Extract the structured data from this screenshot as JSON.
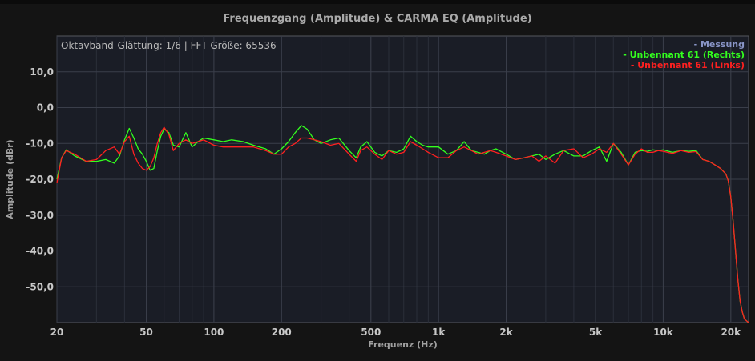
{
  "chart_data": {
    "type": "line",
    "title": "Frequenzgang (Amplitude) & CARMA EQ (Amplitude)",
    "info": "Oktavband-Glättung: 1/6 | FFT Größe: 65536",
    "xlabel": "Frequenz (Hz)",
    "ylabel": "Amplitude (dBr)",
    "xscale": "log",
    "xlim": [
      20,
      24000
    ],
    "ylim": [
      -60,
      20
    ],
    "grid": true,
    "legend_position": "top-right",
    "x_ticks": [
      {
        "value": 20,
        "label": "20"
      },
      {
        "value": 50,
        "label": "50"
      },
      {
        "value": 100,
        "label": "100"
      },
      {
        "value": 200,
        "label": "200"
      },
      {
        "value": 500,
        "label": "500"
      },
      {
        "value": 1000,
        "label": "1k"
      },
      {
        "value": 2000,
        "label": "2k"
      },
      {
        "value": 5000,
        "label": "5k"
      },
      {
        "value": 10000,
        "label": "10k"
      },
      {
        "value": 20000,
        "label": "20k"
      }
    ],
    "y_ticks": [
      {
        "value": 10,
        "label": "10,0"
      },
      {
        "value": 0,
        "label": "0,0"
      },
      {
        "value": -10,
        "label": "-10,0"
      },
      {
        "value": -20,
        "label": "-20,0"
      },
      {
        "value": -30,
        "label": "-30,0"
      },
      {
        "value": -40,
        "label": "-40,0"
      },
      {
        "value": -50,
        "label": "-50,0"
      }
    ],
    "legend": [
      {
        "label": "- Messung",
        "color": "#8a96c8"
      },
      {
        "label": "- Unbennant 61 (Rechts)",
        "color": "#33ff1e"
      },
      {
        "label": "- Unbennant 61 (Links)",
        "color": "#ff2020"
      }
    ],
    "series": [
      {
        "name": "Unbennant 61 (Rechts)",
        "color": "#33ff1e",
        "x": [
          20,
          21,
          22,
          24,
          27,
          30,
          33,
          36,
          38,
          40,
          42,
          44,
          46,
          48,
          50,
          52,
          54,
          56,
          58,
          60,
          63,
          66,
          70,
          75,
          80,
          85,
          90,
          100,
          110,
          120,
          135,
          150,
          170,
          185,
          200,
          215,
          230,
          245,
          260,
          280,
          300,
          330,
          360,
          400,
          430,
          450,
          480,
          520,
          560,
          600,
          650,
          700,
          750,
          800,
          850,
          900,
          1000,
          1100,
          1200,
          1300,
          1400,
          1500,
          1600,
          1700,
          1800,
          2000,
          2200,
          2400,
          2600,
          2800,
          3000,
          3300,
          3600,
          4000,
          4400,
          4800,
          5200,
          5600,
          6000,
          6500,
          7000,
          7500,
          8000,
          8500,
          9000,
          9500,
          10000,
          11000,
          12000,
          13000,
          14000,
          15000,
          16000,
          17000,
          18000,
          19000,
          19500,
          20000,
          20500,
          21000,
          21500,
          22000,
          22500,
          23000,
          23500,
          24000
        ],
        "y": [
          -20,
          -14,
          -11.8,
          -13.5,
          -15,
          -15,
          -14.5,
          -15.5,
          -13.5,
          -9,
          -5.8,
          -8.5,
          -11.5,
          -13,
          -15,
          -17.5,
          -17,
          -12,
          -8,
          -6,
          -7,
          -10.5,
          -11,
          -7,
          -11,
          -9.5,
          -8.5,
          -9,
          -9.5,
          -9,
          -9.5,
          -10.5,
          -11.5,
          -13,
          -11.5,
          -9.5,
          -7,
          -5,
          -6,
          -9,
          -10,
          -9,
          -8.5,
          -12,
          -14,
          -11,
          -9.5,
          -12.5,
          -13.5,
          -12,
          -12.5,
          -11.5,
          -8,
          -9.5,
          -10.5,
          -11,
          -11,
          -13,
          -12,
          -9.5,
          -12,
          -12.5,
          -13,
          -12,
          -11.5,
          -13,
          -14.5,
          -14,
          -13.5,
          -13,
          -14.5,
          -13,
          -12,
          -13.5,
          -13.5,
          -12,
          -11,
          -15,
          -10,
          -12.5,
          -16,
          -12.5,
          -12,
          -12.2,
          -11.8,
          -12,
          -11.8,
          -12.5,
          -12,
          -12.2,
          -12,
          -14.5,
          -15,
          -16,
          -17,
          -18.5,
          -20.5,
          -25,
          -32,
          -40,
          -48,
          -54,
          -57,
          -59,
          -59.5,
          -60
        ]
      },
      {
        "name": "Unbennant 61 (Links)",
        "color": "#ff2020",
        "x": [
          20,
          21,
          22,
          24,
          27,
          30,
          33,
          36,
          38,
          40,
          42,
          44,
          46,
          48,
          50,
          52,
          54,
          56,
          58,
          60,
          63,
          66,
          70,
          75,
          80,
          85,
          90,
          100,
          110,
          120,
          135,
          150,
          170,
          185,
          200,
          215,
          230,
          245,
          260,
          280,
          300,
          330,
          360,
          400,
          430,
          450,
          480,
          520,
          560,
          600,
          650,
          700,
          750,
          800,
          850,
          900,
          1000,
          1100,
          1200,
          1300,
          1400,
          1500,
          1600,
          1700,
          1800,
          2000,
          2200,
          2400,
          2600,
          2800,
          3000,
          3300,
          3600,
          4000,
          4400,
          4800,
          5200,
          5600,
          6000,
          6500,
          7000,
          7500,
          8000,
          8500,
          9000,
          9500,
          10000,
          11000,
          12000,
          13000,
          14000,
          15000,
          16000,
          17000,
          18000,
          19000,
          19500,
          20000,
          20500,
          21000,
          21500,
          22000,
          22500,
          23000,
          23500,
          24000
        ],
        "y": [
          -21,
          -14,
          -12,
          -13,
          -15,
          -14.5,
          -12,
          -11,
          -13,
          -9.5,
          -8,
          -13,
          -15.5,
          -17,
          -17.5,
          -16.5,
          -14,
          -10,
          -7,
          -5.5,
          -7.5,
          -12,
          -10,
          -9,
          -10,
          -9.5,
          -9,
          -10.5,
          -11,
          -11,
          -11,
          -11,
          -12,
          -13,
          -13,
          -11,
          -10,
          -8.5,
          -8.5,
          -9,
          -9.5,
          -10.5,
          -10,
          -13,
          -15,
          -12,
          -11,
          -13,
          -14.5,
          -12,
          -13,
          -12.5,
          -9.5,
          -10.5,
          -11.5,
          -12.5,
          -14,
          -14,
          -12,
          -11,
          -12,
          -13,
          -12.5,
          -12,
          -12.5,
          -13.5,
          -14.5,
          -14,
          -13.5,
          -15,
          -13.5,
          -15.5,
          -12,
          -11.5,
          -14,
          -13,
          -11.5,
          -12.5,
          -10,
          -13,
          -16,
          -13,
          -11.5,
          -12.5,
          -12.5,
          -12,
          -12.2,
          -12.8,
          -12,
          -12.5,
          -12.3,
          -14.5,
          -15,
          -16,
          -17,
          -18.5,
          -20.5,
          -25,
          -32,
          -40,
          -48,
          -54,
          -57,
          -59,
          -59.5,
          -60
        ]
      }
    ]
  }
}
